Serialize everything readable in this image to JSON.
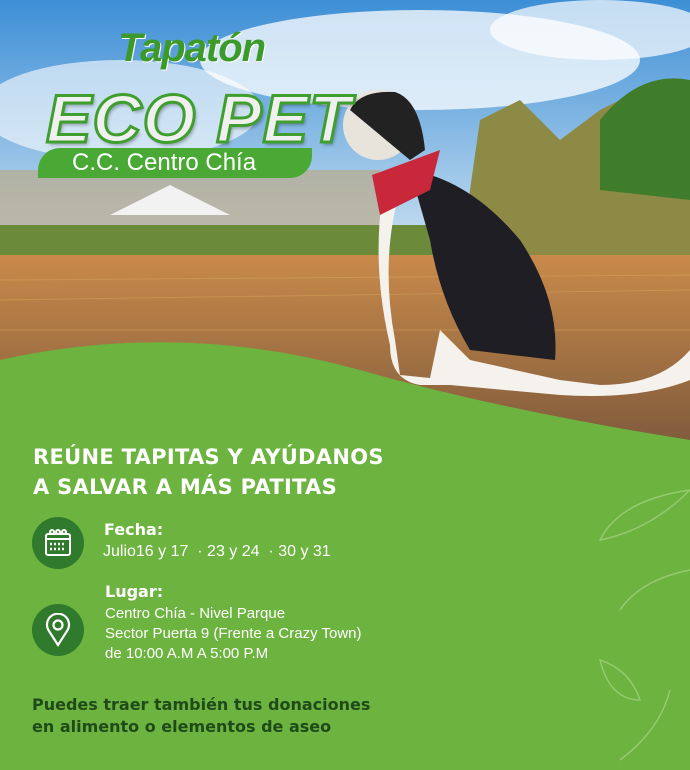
{
  "logo": {
    "script": "Tapatón",
    "main": "ECO PET",
    "venue": "C.C. Centro Chía"
  },
  "headline": {
    "line1": "REÚNE TAPITAS Y AYÚDANOS",
    "line2": "A SALVAR A MÁS PATITAS"
  },
  "date": {
    "icon": "calendar-icon",
    "label": "Fecha:",
    "value": "Julio16 y 17  · 23 y 24  · 30 y 31"
  },
  "place": {
    "icon": "location-pin-icon",
    "label": "Lugar:",
    "line1": "Centro Chía - Nivel Parque",
    "line2": "Sector Puerta 9 (Frente a Crazy Town)",
    "line3": "de 10:00 A.M A 5:00 P.M"
  },
  "footer": {
    "line1": "Puedes traer también tus donaciones",
    "line2": "en alimento o elementos de aseo"
  },
  "colors": {
    "green": "#6db33f",
    "dark_green": "#2f7a2c",
    "logo_green": "#49a934"
  }
}
